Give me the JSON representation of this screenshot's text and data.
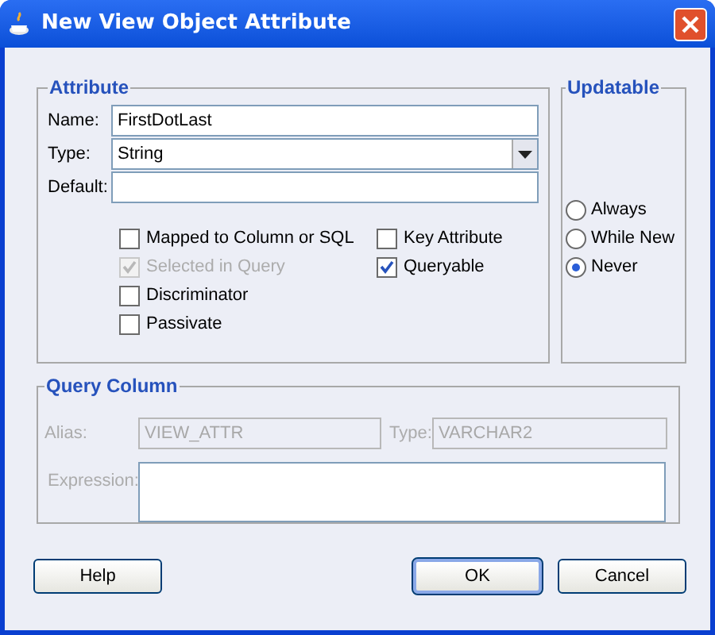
{
  "window": {
    "title": "New View Object Attribute"
  },
  "attribute": {
    "title": "Attribute",
    "fields": [
      {
        "label": "Name:",
        "value": "FirstDotLast",
        "kind": "text"
      },
      {
        "label": "Type:",
        "value": "String",
        "kind": "dropdown"
      },
      {
        "label": "Default:",
        "kind": "text"
      }
    ],
    "checkboxes_left": [
      {
        "label": "Mapped to Column or SQL",
        "checked": false,
        "disabled": false
      },
      {
        "label": "Selected in Query",
        "checked": true,
        "disabled": true
      },
      {
        "label": "Discriminator",
        "checked": false,
        "disabled": false
      },
      {
        "label": "Passivate",
        "checked": false,
        "disabled": false
      }
    ],
    "checkboxes_right": [
      {
        "label": "Key Attribute",
        "checked": false,
        "disabled": false
      },
      {
        "label": "Queryable",
        "checked": true,
        "disabled": false
      }
    ]
  },
  "updatable": {
    "title": "Updatable",
    "options": [
      {
        "label": "Always",
        "selected": false
      },
      {
        "label": "While New",
        "selected": false
      },
      {
        "label": "Never",
        "selected": true
      }
    ]
  },
  "query_column": {
    "title": "Query Column",
    "disabled": true,
    "alias": {
      "label": "Alias:",
      "value": "VIEW_ATTR"
    },
    "type": {
      "label": "Type:",
      "value": "VARCHAR2"
    },
    "expression": {
      "label": "Expression:"
    }
  },
  "buttons": [
    {
      "label": "Help",
      "default": false
    },
    {
      "label": "OK",
      "default": true
    },
    {
      "label": "Cancel",
      "default": false
    }
  ]
}
